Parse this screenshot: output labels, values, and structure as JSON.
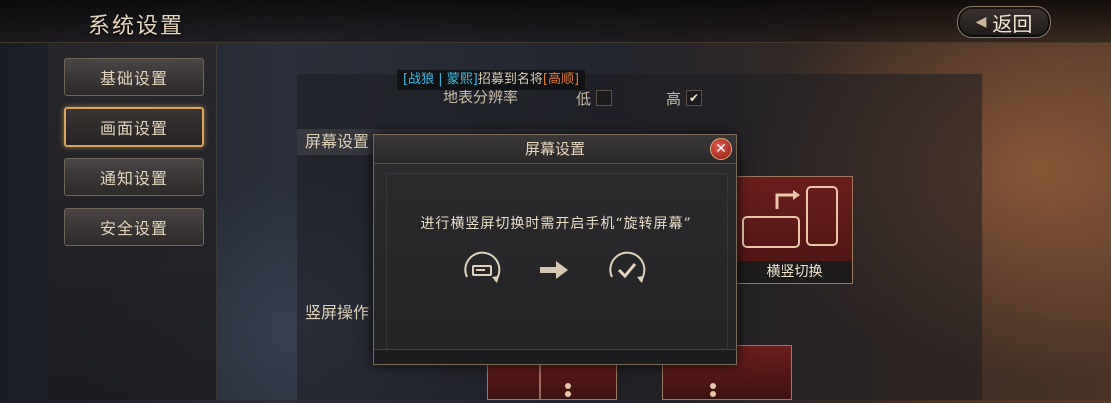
{
  "header": {
    "title": "系统设置",
    "back_label": "返回",
    "back_icon": "back-arrow-icon"
  },
  "nav": {
    "items": [
      {
        "label": "基础设置",
        "active": false
      },
      {
        "label": "画面设置",
        "active": true
      },
      {
        "label": "通知设置",
        "active": false
      },
      {
        "label": "安全设置",
        "active": false
      }
    ]
  },
  "announcement": {
    "bracket_open": "[",
    "name1": "战狼",
    "sep": " | ",
    "name2": "蒙熙",
    "bracket_close": "]",
    "text": "招募到名将",
    "general_open": "[",
    "general": "高顺",
    "general_close": "]",
    "colors": {
      "name": "#3fb8e0",
      "general": "#e07a3a",
      "text": "#d8ccb6"
    }
  },
  "settings": {
    "terrain_label": "地表分辨率",
    "low_label": "低",
    "high_label": "高",
    "high_checked": true,
    "screen_section": "屏幕设置",
    "orientation_card_label": "横竖切换",
    "portrait_section": "竖屏操作"
  },
  "modal": {
    "title": "屏幕设置",
    "message": "进行横竖屏切换时需开启手机“旋转屏幕”",
    "icons": [
      "rotate-screen-icon",
      "arrow-right-icon",
      "rotate-check-icon"
    ]
  }
}
